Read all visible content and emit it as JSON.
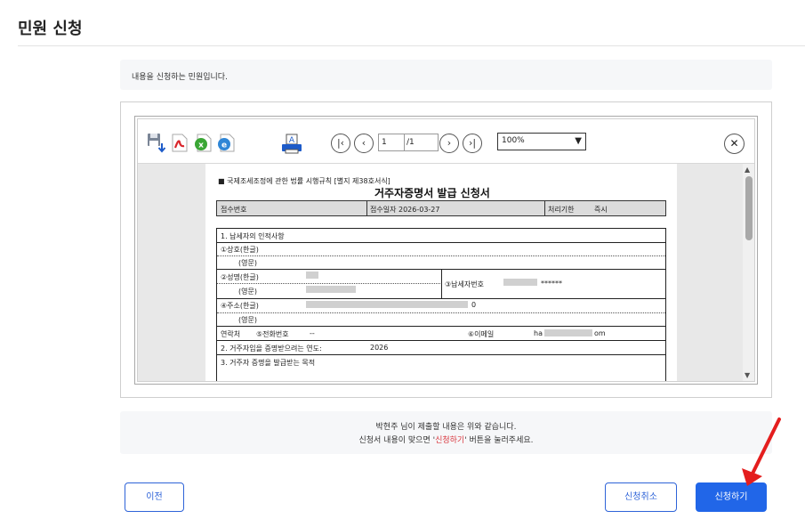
{
  "page": {
    "title": "민원 신청"
  },
  "intro": {
    "text": "내용을 신청하는 민원입니다."
  },
  "viewer": {
    "page_current": "1",
    "page_total": "/1",
    "zoom": "100%",
    "doc": {
      "law_ref": "■ 국제조세조정에 관한 법률 시행규칙 [별지 제38호서식]",
      "title": "거주자증명서 발급 신청서",
      "header": {
        "receipt_no": "접수번호",
        "receipt_date": "접수일자 2026-03-27",
        "processing_period": "처리기한",
        "processing_value": "즉시"
      },
      "section1": "1. 납세자의 인적사항",
      "trade_name_kr": "①상호(한글)",
      "trade_name_en": "(영문)",
      "name_kr": "②성명(한글)",
      "name_en": "(영문)",
      "taxpayer_no_label": "③납세자번호",
      "taxpayer_no_value": "******",
      "address_kr": "④주소(한글)",
      "address_suffix": "0",
      "address_en": "(영문)",
      "contact_label": "연락처",
      "phone_label": "⑤전화번호",
      "phone_value": "--",
      "email_label": "⑥이메일",
      "email_prefix": "ha",
      "email_suffix": "om",
      "section2": "2. 거주자임을 증명받으려는 연도:",
      "section2_year": "2026",
      "section3": "3. 거주자 증명을 발급받는 목적"
    }
  },
  "notice": {
    "line1": "박현주 님이 제출할 내용은 위와 같습니다.",
    "line2_pre": "신청서 내용이 맞으면 '",
    "line2_hl": "신청하기",
    "line2_post": "' 버튼을 눌러주세요."
  },
  "buttons": {
    "prev": "이전",
    "cancel": "신청취소",
    "submit": "신청하기"
  },
  "colors": {
    "primary": "#2166e8",
    "highlight": "#d9363e",
    "arrow": "#e41e1e"
  }
}
